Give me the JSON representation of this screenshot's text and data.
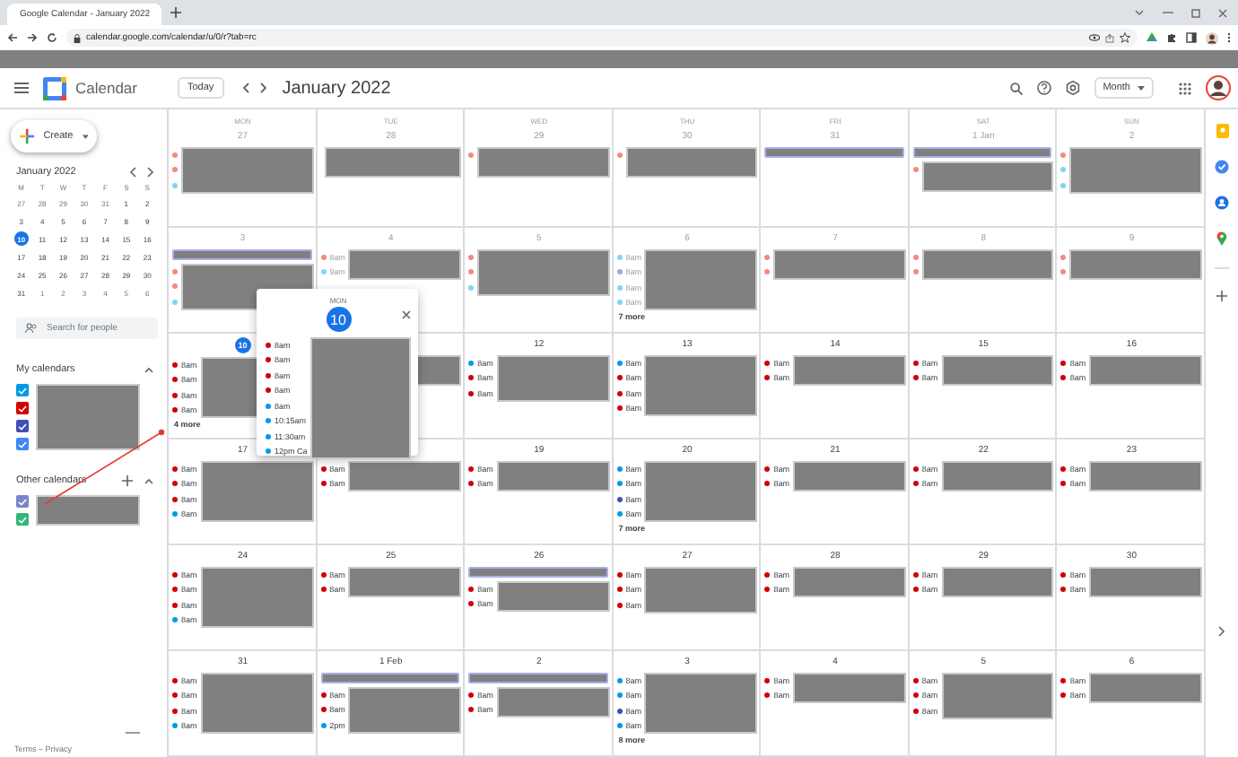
{
  "browser": {
    "tab_title": "Google Calendar - January 2022",
    "url": "calendar.google.com/calendar/u/0/r?tab=rc"
  },
  "header": {
    "app_name": "Calendar",
    "today_button": "Today",
    "period": "January 2022",
    "view": "Month"
  },
  "sidebar": {
    "create": "Create",
    "mini_calendar": {
      "title": "January 2022",
      "weekdays": [
        "M",
        "T",
        "W",
        "T",
        "F",
        "S",
        "S"
      ],
      "weeks": [
        [
          {
            "day": "27",
            "other_month": true,
            "selected": false
          },
          {
            "day": "28",
            "other_month": true,
            "selected": false
          },
          {
            "day": "29",
            "other_month": true,
            "selected": false
          },
          {
            "day": "30",
            "other_month": true,
            "selected": false
          },
          {
            "day": "31",
            "other_month": true,
            "selected": false
          },
          {
            "day": "1",
            "other_month": false,
            "selected": false
          },
          {
            "day": "2",
            "other_month": false,
            "selected": false
          }
        ],
        [
          {
            "day": "3",
            "other_month": false,
            "selected": false
          },
          {
            "day": "4",
            "other_month": false,
            "selected": false
          },
          {
            "day": "5",
            "other_month": false,
            "selected": false
          },
          {
            "day": "6",
            "other_month": false,
            "selected": false
          },
          {
            "day": "7",
            "other_month": false,
            "selected": false
          },
          {
            "day": "8",
            "other_month": false,
            "selected": false
          },
          {
            "day": "9",
            "other_month": false,
            "selected": false
          }
        ],
        [
          {
            "day": "10",
            "other_month": false,
            "selected": true
          },
          {
            "day": "11",
            "other_month": false,
            "selected": false
          },
          {
            "day": "12",
            "other_month": false,
            "selected": false
          },
          {
            "day": "13",
            "other_month": false,
            "selected": false
          },
          {
            "day": "14",
            "other_month": false,
            "selected": false
          },
          {
            "day": "15",
            "other_month": false,
            "selected": false
          },
          {
            "day": "16",
            "other_month": false,
            "selected": false
          }
        ],
        [
          {
            "day": "17",
            "other_month": false,
            "selected": false
          },
          {
            "day": "18",
            "other_month": false,
            "selected": false
          },
          {
            "day": "19",
            "other_month": false,
            "selected": false
          },
          {
            "day": "20",
            "other_month": false,
            "selected": false
          },
          {
            "day": "21",
            "other_month": false,
            "selected": false
          },
          {
            "day": "22",
            "other_month": false,
            "selected": false
          },
          {
            "day": "23",
            "other_month": false,
            "selected": false
          }
        ],
        [
          {
            "day": "24",
            "other_month": false,
            "selected": false
          },
          {
            "day": "25",
            "other_month": false,
            "selected": false
          },
          {
            "day": "26",
            "other_month": false,
            "selected": false
          },
          {
            "day": "27",
            "other_month": false,
            "selected": false
          },
          {
            "day": "28",
            "other_month": false,
            "selected": false
          },
          {
            "day": "29",
            "other_month": false,
            "selected": false
          },
          {
            "day": "30",
            "other_month": false,
            "selected": false
          }
        ],
        [
          {
            "day": "31",
            "other_month": false,
            "selected": false
          },
          {
            "day": "1",
            "other_month": true,
            "selected": false
          },
          {
            "day": "2",
            "other_month": true,
            "selected": false
          },
          {
            "day": "3",
            "other_month": true,
            "selected": false
          },
          {
            "day": "4",
            "other_month": true,
            "selected": false
          },
          {
            "day": "5",
            "other_month": true,
            "selected": false
          },
          {
            "day": "6",
            "other_month": true,
            "selected": false
          }
        ]
      ]
    },
    "search": {
      "placeholder": "Search for people"
    },
    "calendar_groups": [
      {
        "title": "My calendars",
        "expanded": true,
        "items": [
          {
            "color": "#039be5",
            "checked": true
          },
          {
            "color": "#d50000",
            "checked": true
          },
          {
            "color": "#3f51b5",
            "checked": true
          },
          {
            "color": "#4285f4",
            "checked": true
          }
        ]
      },
      {
        "title": "Other calendars",
        "expanded": true,
        "add": true,
        "items": [
          {
            "color": "#7986cb",
            "checked": true
          },
          {
            "color": "#33b679",
            "checked": true
          }
        ]
      }
    ],
    "footer": "Terms – Privacy"
  },
  "grid": {
    "weekdays": [
      "MON",
      "TUE",
      "WED",
      "THU",
      "FRI",
      "SAT",
      "SUN"
    ],
    "weeks": [
      {
        "days": [
          {
            "date": "27",
            "past": true,
            "redacted": true,
            "events": [
              {
                "color": "#f28b82"
              },
              {
                "color": "#f28b82"
              },
              {
                "color": "#81d4fa"
              }
            ]
          },
          {
            "date": "28",
            "past": true,
            "redacted": true
          },
          {
            "date": "29",
            "past": true,
            "redacted": true,
            "events": [
              {
                "color": "#f28b82"
              }
            ]
          },
          {
            "date": "30",
            "past": true,
            "redacted": true,
            "events": [
              {
                "color": "#f28b82"
              }
            ]
          },
          {
            "date": "31",
            "past": true,
            "all_day": true,
            "redacted": false
          },
          {
            "date": "1 Jan",
            "past": true,
            "all_day": true,
            "redacted": true,
            "events": [
              {
                "color": "#f28b82"
              }
            ]
          },
          {
            "date": "2",
            "past": true,
            "redacted": true,
            "events": [
              {
                "color": "#f28b82"
              },
              {
                "color": "#81d4fa"
              },
              {
                "color": "#81d4fa"
              }
            ]
          }
        ]
      },
      {
        "days": [
          {
            "date": "3",
            "past": true,
            "all_day": true,
            "redacted": true,
            "events": [
              {
                "color": "#f28b82"
              },
              {
                "color": "#f28b82"
              },
              {
                "color": "#81d4fa"
              }
            ]
          },
          {
            "date": "4",
            "past": true,
            "redacted": true,
            "events": [
              {
                "time": "8am",
                "color": "#f28b82"
              },
              {
                "time": "9am",
                "color": "#81d4fa"
              }
            ]
          },
          {
            "date": "5",
            "past": true,
            "redacted": true,
            "events": [
              {
                "color": "#f28b82"
              },
              {
                "color": "#f28b82"
              },
              {
                "color": "#81d4fa"
              }
            ]
          },
          {
            "date": "6",
            "past": true,
            "redacted": true,
            "events": [
              {
                "time": "8am",
                "color": "#81d4fa"
              },
              {
                "time": "8am",
                "color": "#9fa8da"
              },
              {
                "time": "8am",
                "color": "#81d4fa"
              },
              {
                "time": "8am",
                "color": "#81d4fa"
              }
            ],
            "more": "7 more"
          },
          {
            "date": "7",
            "past": true,
            "redacted": true,
            "events": [
              {
                "color": "#f28b82"
              },
              {
                "color": "#f28b82"
              }
            ]
          },
          {
            "date": "8",
            "past": true,
            "redacted": true,
            "events": [
              {
                "color": "#f28b82"
              },
              {
                "color": "#f28b82"
              }
            ]
          },
          {
            "date": "9",
            "past": true,
            "redacted": true,
            "events": [
              {
                "color": "#f28b82"
              },
              {
                "color": "#f28b82"
              }
            ]
          }
        ]
      },
      {
        "days": [
          {
            "date": "10",
            "today": true,
            "redacted": true,
            "events": [
              {
                "time": "8am",
                "color": "#d50000"
              },
              {
                "time": "8am",
                "color": "#d50000"
              },
              {
                "time": "8am",
                "color": "#d50000"
              },
              {
                "time": "8am",
                "color": "#d50000"
              }
            ],
            "more": "4 more"
          },
          {
            "redacted": true
          },
          {
            "date": "12",
            "redacted": true,
            "events": [
              {
                "time": "8am",
                "color": "#039be5"
              },
              {
                "time": "8am",
                "color": "#d50000"
              },
              {
                "time": "8am",
                "color": "#d50000"
              }
            ]
          },
          {
            "date": "13",
            "redacted": true,
            "events": [
              {
                "time": "8am",
                "color": "#039be5"
              },
              {
                "time": "8am",
                "color": "#d50000"
              },
              {
                "time": "8am",
                "color": "#d50000"
              },
              {
                "time": "8am",
                "color": "#d50000"
              }
            ]
          },
          {
            "date": "14",
            "redacted": true,
            "events": [
              {
                "time": "8am",
                "color": "#d50000"
              },
              {
                "time": "8am",
                "color": "#d50000"
              }
            ]
          },
          {
            "date": "15",
            "redacted": true,
            "events": [
              {
                "time": "8am",
                "color": "#d50000"
              },
              {
                "time": "8am",
                "color": "#d50000"
              }
            ]
          },
          {
            "date": "16",
            "redacted": true,
            "events": [
              {
                "time": "8am",
                "color": "#d50000"
              },
              {
                "time": "8am",
                "color": "#d50000"
              }
            ]
          }
        ]
      },
      {
        "days": [
          {
            "date": "17",
            "redacted": true,
            "events": [
              {
                "time": "8am",
                "color": "#d50000"
              },
              {
                "time": "8am",
                "color": "#d50000"
              },
              {
                "time": "8am",
                "color": "#d50000"
              },
              {
                "time": "8am",
                "color": "#039be5"
              }
            ]
          },
          {
            "redacted": true,
            "events": [
              {
                "time": "8am",
                "color": "#d50000"
              },
              {
                "time": "8am",
                "color": "#d50000"
              }
            ]
          },
          {
            "date": "19",
            "redacted": true,
            "events": [
              {
                "time": "8am",
                "color": "#d50000"
              },
              {
                "time": "8am",
                "color": "#d50000"
              }
            ]
          },
          {
            "date": "20",
            "redacted": true,
            "events": [
              {
                "time": "8am",
                "color": "#039be5"
              },
              {
                "time": "8am",
                "color": "#039be5"
              },
              {
                "time": "8am",
                "color": "#3f51b5"
              },
              {
                "time": "8am",
                "color": "#039be5"
              }
            ],
            "more": "7 more"
          },
          {
            "date": "21",
            "redacted": true,
            "events": [
              {
                "time": "8am",
                "color": "#d50000"
              },
              {
                "time": "8am",
                "color": "#d50000"
              }
            ]
          },
          {
            "date": "22",
            "redacted": true,
            "events": [
              {
                "time": "8am",
                "color": "#d50000"
              },
              {
                "time": "8am",
                "color": "#d50000"
              }
            ]
          },
          {
            "date": "23",
            "redacted": true,
            "events": [
              {
                "time": "8am",
                "color": "#d50000"
              },
              {
                "time": "8am",
                "color": "#d50000"
              }
            ]
          }
        ]
      },
      {
        "days": [
          {
            "date": "24",
            "redacted": true,
            "events": [
              {
                "time": "8am",
                "color": "#d50000"
              },
              {
                "time": "8am",
                "color": "#d50000"
              },
              {
                "time": "8am",
                "color": "#d50000"
              },
              {
                "time": "8am",
                "color": "#039be5"
              }
            ]
          },
          {
            "date": "25",
            "redacted": true,
            "events": [
              {
                "time": "8am",
                "color": "#d50000"
              },
              {
                "time": "8am",
                "color": "#d50000"
              }
            ]
          },
          {
            "date": "26",
            "all_day": true,
            "redacted": true,
            "events": [
              {
                "time": "8am",
                "color": "#d50000"
              },
              {
                "time": "8am",
                "color": "#d50000"
              }
            ]
          },
          {
            "date": "27",
            "redacted": true,
            "events": [
              {
                "time": "8am",
                "color": "#d50000"
              },
              {
                "time": "8am",
                "color": "#d50000"
              },
              {
                "time": "8am",
                "color": "#d50000"
              }
            ]
          },
          {
            "date": "28",
            "redacted": true,
            "events": [
              {
                "time": "8am",
                "color": "#d50000"
              },
              {
                "time": "8am",
                "color": "#d50000"
              }
            ]
          },
          {
            "date": "29",
            "redacted": true,
            "events": [
              {
                "time": "8am",
                "color": "#d50000"
              },
              {
                "time": "8am",
                "color": "#d50000"
              }
            ]
          },
          {
            "date": "30",
            "redacted": true,
            "events": [
              {
                "time": "8am",
                "color": "#d50000"
              },
              {
                "time": "8am",
                "color": "#d50000"
              }
            ]
          }
        ]
      },
      {
        "days": [
          {
            "date": "31",
            "redacted": true,
            "events": [
              {
                "time": "8am",
                "color": "#d50000"
              },
              {
                "time": "8am",
                "color": "#d50000"
              },
              {
                "time": "8am",
                "color": "#d50000"
              },
              {
                "time": "8am",
                "color": "#039be5"
              }
            ]
          },
          {
            "date": "1 Feb",
            "all_day": true,
            "redacted": true,
            "events": [
              {
                "time": "8am",
                "color": "#d50000"
              },
              {
                "time": "8am",
                "color": "#d50000"
              },
              {
                "time": "2pm",
                "color": "#039be5"
              }
            ]
          },
          {
            "date": "2",
            "all_day": true,
            "redacted": true,
            "events": [
              {
                "time": "8am",
                "color": "#d50000"
              },
              {
                "time": "8am",
                "color": "#d50000"
              }
            ]
          },
          {
            "date": "3",
            "redacted": true,
            "events": [
              {
                "time": "8am",
                "color": "#039be5"
              },
              {
                "time": "8am",
                "color": "#039be5"
              },
              {
                "time": "8am",
                "color": "#3f51b5"
              },
              {
                "time": "8am",
                "color": "#039be5"
              }
            ],
            "more": "8 more"
          },
          {
            "date": "4",
            "redacted": true,
            "events": [
              {
                "time": "8am",
                "color": "#d50000"
              },
              {
                "time": "8am",
                "color": "#d50000"
              }
            ]
          },
          {
            "date": "5",
            "redacted": true,
            "events": [
              {
                "time": "8am",
                "color": "#d50000"
              },
              {
                "time": "8am",
                "color": "#d50000"
              },
              {
                "time": "8am",
                "color": "#d50000"
              }
            ]
          },
          {
            "date": "6",
            "redacted": true,
            "events": [
              {
                "time": "8am",
                "color": "#d50000"
              },
              {
                "time": "8am",
                "color": "#d50000"
              }
            ]
          }
        ]
      }
    ]
  },
  "popup": {
    "weekday": "MON",
    "date": "10",
    "redacted": true,
    "events": [
      {
        "time": "8am",
        "color": "#d50000"
      },
      {
        "time": "8am",
        "color": "#d50000"
      },
      {
        "time": "8am",
        "color": "#d50000"
      },
      {
        "time": "8am",
        "color": "#d50000"
      },
      {
        "time": "8am",
        "color": "#039be5"
      },
      {
        "time": "10:15am",
        "color": "#039be5"
      },
      {
        "time": "11:30am",
        "color": "#039be5"
      },
      {
        "time": "12pm Ca",
        "color": "#039be5"
      }
    ]
  }
}
